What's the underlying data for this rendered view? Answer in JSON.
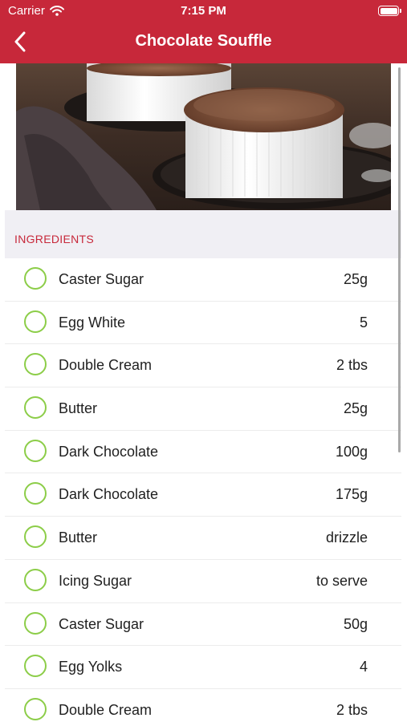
{
  "status_bar": {
    "carrier": "Carrier",
    "time": "7:15 PM"
  },
  "nav": {
    "title": "Chocolate Souffle"
  },
  "hero_image": {
    "subject": "two chocolate souffles in white ramekins dusted with icing sugar"
  },
  "ingredients": {
    "title": "INGREDIENTS",
    "items": [
      {
        "name": "Caster Sugar",
        "qty": "25g"
      },
      {
        "name": "Egg White",
        "qty": "5"
      },
      {
        "name": "Double Cream",
        "qty": "2 tbs"
      },
      {
        "name": "Butter",
        "qty": "25g"
      },
      {
        "name": "Dark Chocolate",
        "qty": "100g"
      },
      {
        "name": "Dark Chocolate",
        "qty": "175g"
      },
      {
        "name": "Butter",
        "qty": "drizzle"
      },
      {
        "name": "Icing Sugar",
        "qty": "to serve"
      },
      {
        "name": "Caster Sugar",
        "qty": "50g"
      },
      {
        "name": "Egg Yolks",
        "qty": "4"
      },
      {
        "name": "Double Cream",
        "qty": "2 tbs"
      }
    ]
  },
  "colors": {
    "brand": "#c7283a",
    "check": "#8ccd48",
    "section_bg": "#f0eff4"
  },
  "icons": [
    "wifi-icon",
    "battery-icon",
    "back-chevron-icon",
    "check-circle-icon"
  ]
}
